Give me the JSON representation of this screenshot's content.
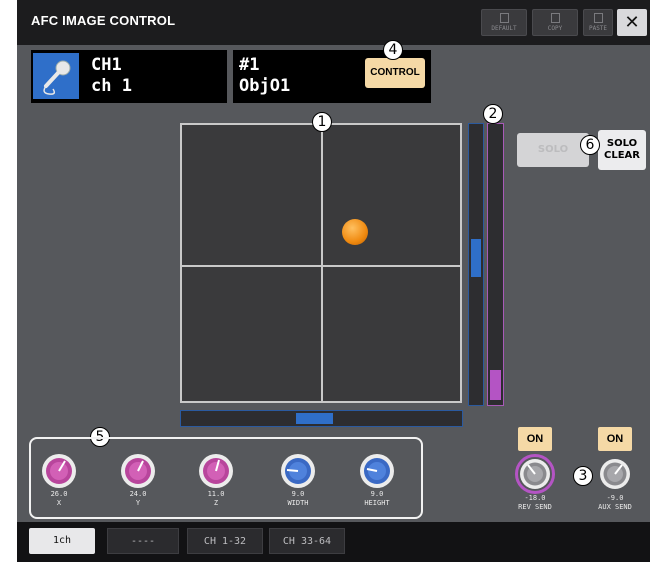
{
  "window": {
    "title": "AFC IMAGE CONTROL"
  },
  "toolbar": {
    "default_label": "DEFAULT",
    "copy_label": "COPY",
    "paste_label": "PASTE",
    "close_label": "✕"
  },
  "channel": {
    "line1": "CH1",
    "line2": "ch 1"
  },
  "scene": {
    "line1": "#1",
    "line2": "ObjO1",
    "control_label": "CONTROL"
  },
  "solo": {
    "solo_label": "SOLO",
    "clear_line1": "SOLO",
    "clear_line2": "CLEAR"
  },
  "callouts": [
    "1",
    "2",
    "3",
    "4",
    "5",
    "6"
  ],
  "knobs": [
    {
      "value": "26.0",
      "label": "X",
      "color": "#b8459c"
    },
    {
      "value": "24.0",
      "label": "Y",
      "color": "#b8459c"
    },
    {
      "value": "11.0",
      "label": "Z",
      "color": "#b8459c"
    },
    {
      "value": "9.0",
      "label": "WIDTH",
      "color": "#3a69c4"
    },
    {
      "value": "9.0",
      "label": "HEIGHT",
      "color": "#3a69c4"
    }
  ],
  "sends": [
    {
      "on_label": "ON",
      "value": "-18.0",
      "label": "REV SEND"
    },
    {
      "on_label": "ON",
      "value": "-9.0",
      "label": "AUX SEND"
    }
  ],
  "tabs": [
    {
      "label": "1ch",
      "active": true
    },
    {
      "label": "----",
      "active": false
    },
    {
      "label": "CH 1-32",
      "active": false
    },
    {
      "label": "CH 33-64",
      "active": false
    }
  ],
  "colors": {
    "accent_blue": "#2f6fc9",
    "accent_purple": "#b454c4",
    "on_button": "#f5d9a6"
  }
}
